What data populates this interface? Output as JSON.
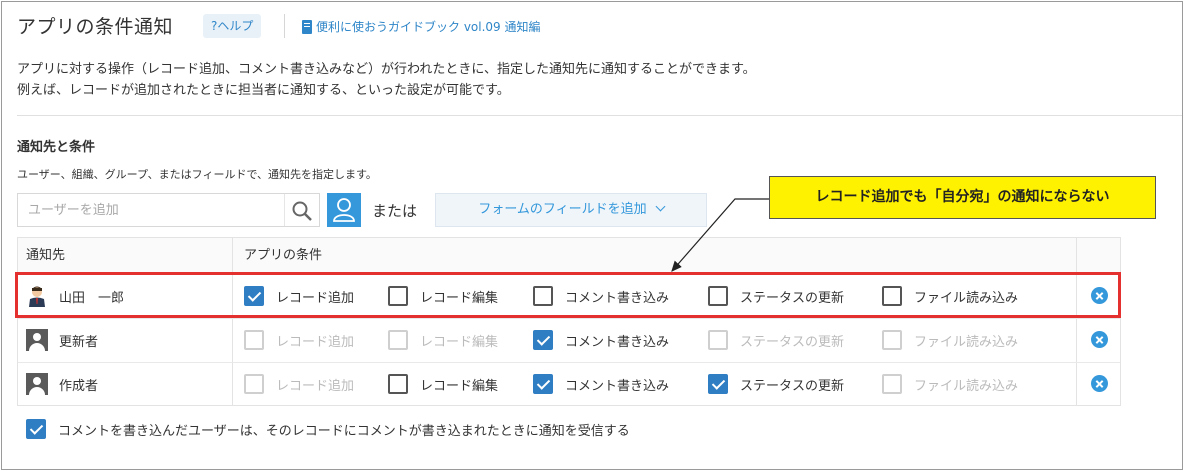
{
  "header": {
    "title": "アプリの条件通知",
    "help_label": "?ヘルプ",
    "guide_label": "便利に使おうガイドブック vol.09 通知編"
  },
  "description": {
    "line1": "アプリに対する操作（レコード追加、コメント書き込みなど）が行われたときに、指定した通知先に通知することができます。",
    "line2": "例えば、レコードが追加されたときに担当者に通知する、といった設定が可能です。"
  },
  "section": {
    "title": "通知先と条件",
    "desc": "ユーザー、組織、グループ、またはフィールドで、通知先を指定します。"
  },
  "controls": {
    "search_placeholder": "ユーザーを追加",
    "or_label": "または",
    "field_dropdown_label": "フォームのフィールドを追加"
  },
  "table": {
    "headers": {
      "target": "通知先",
      "conditions": "アプリの条件"
    },
    "condition_labels": [
      "レコード追加",
      "レコード編集",
      "コメント書き込み",
      "ステータスの更新",
      "ファイル読み込み"
    ],
    "rows": [
      {
        "name": "山田　一郎",
        "avatar": "user-photo-icon",
        "checks": [
          "checked",
          "unchecked",
          "unchecked",
          "unchecked",
          "unchecked"
        ]
      },
      {
        "name": "更新者",
        "avatar": "person-icon",
        "checks": [
          "disabled",
          "disabled",
          "checked",
          "disabled",
          "disabled"
        ]
      },
      {
        "name": "作成者",
        "avatar": "person-icon",
        "checks": [
          "disabled",
          "unchecked",
          "checked",
          "checked",
          "disabled"
        ]
      }
    ]
  },
  "annotation": {
    "text": "レコード追加でも「自分宛」の通知にならない"
  },
  "footer": {
    "commenter_notify_label": "コメントを書き込んだユーザーは、そのレコードにコメントが書き込まれたときに通知を受信する",
    "commenter_notify_checked": true
  },
  "colors": {
    "accent": "#3498db",
    "checkbox_checked": "#2f7dc2",
    "highlight_border": "#e53030",
    "annotation_bg": "#fff200"
  }
}
